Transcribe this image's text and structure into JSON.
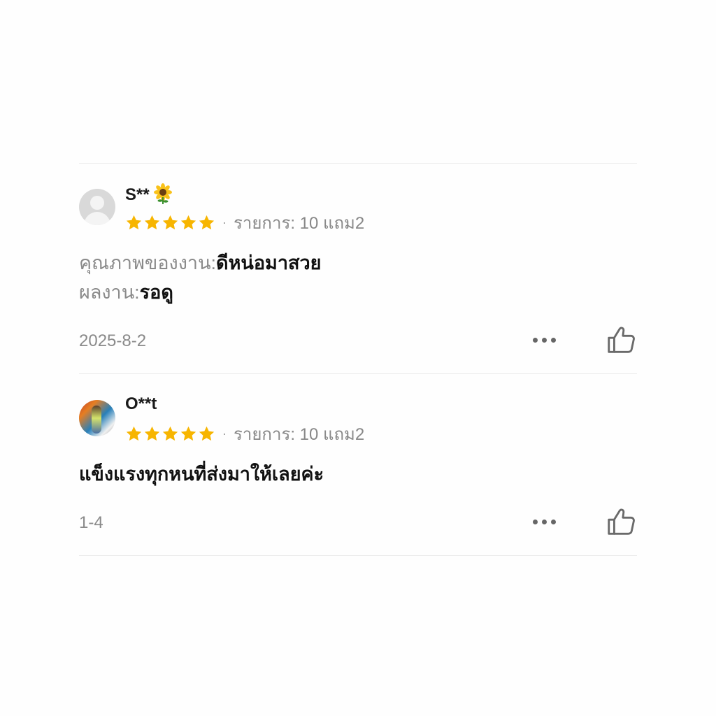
{
  "colors": {
    "star": "#f7b500",
    "muted_text": "#8a8a8a",
    "primary_text": "#111111",
    "divider": "#ececec"
  },
  "reviews": [
    {
      "username": "S**",
      "username_emoji": "sunflower-icon",
      "rating": 5,
      "variant": "รายการ: 10 แถม2",
      "content_lines": [
        {
          "label": "คุณภาพของงาน:",
          "value": "ดีหน่อมาสวย"
        },
        {
          "label": "ผลงาน:",
          "value": "รอดู"
        }
      ],
      "date": "2025-8-2"
    },
    {
      "username": "O**t",
      "rating": 5,
      "variant": "รายการ: 10 แถม2",
      "content": "แข็งแรงทุกหนที่ส่งมาให้เลยค่ะ",
      "date": "1-4"
    }
  ]
}
